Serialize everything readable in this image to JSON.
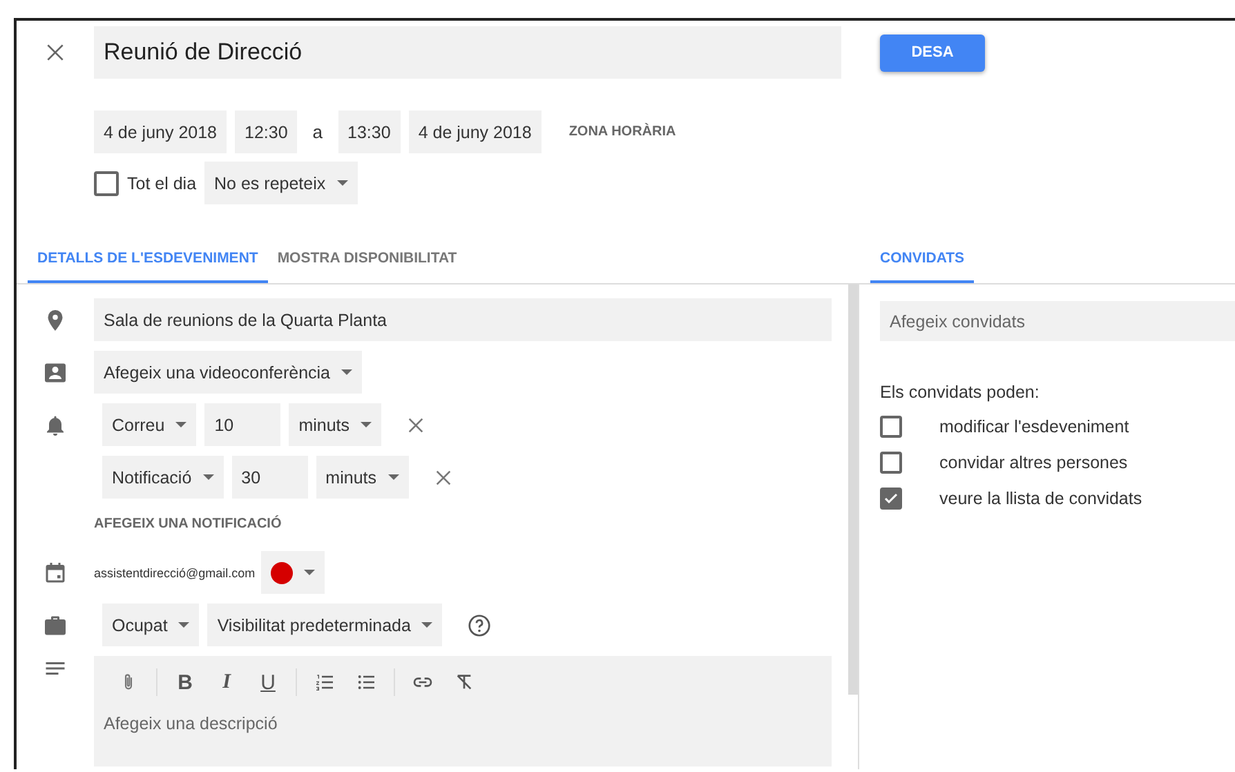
{
  "title": "Reunió de Direcció",
  "save_button": "DESA",
  "date_time": {
    "start_date": "4 de juny 2018",
    "start_time": "12:30",
    "separator": "a",
    "end_time": "13:30",
    "end_date": "4 de juny 2018",
    "time_zone": "ZONA HORÀRIA"
  },
  "all_day": {
    "label": "Tot el dia",
    "checked": false
  },
  "repeat": "No es repeteix",
  "tabs": [
    {
      "label": "DETALLS DE L'ESDEVENIMENT",
      "selected": true
    },
    {
      "label": "MOSTRA DISPONIBILITAT",
      "selected": false
    }
  ],
  "details": {
    "location": "Sala de reunions de la Quarta Planta",
    "conference": "Afegeix una videoconferència",
    "notifications": [
      {
        "method": "Correu",
        "amount": "10",
        "unit": "minuts"
      },
      {
        "method": "Notificació",
        "amount": "30",
        "unit": "minuts"
      }
    ],
    "add_notification": "AFEGEIX UNA NOTIFICACIÓ",
    "calendar": {
      "account": "assistentdirecció@gmail.com",
      "color": "#d50000"
    },
    "availability": "Ocupat",
    "visibility": "Visibilitat predeterminada",
    "format_buttons": [
      "B",
      "I",
      "U"
    ],
    "description": {
      "placeholder": "Afegeix una descripció"
    }
  },
  "guests": {
    "tab": {
      "label": "CONVIDATS",
      "selected": true
    },
    "add_field": {
      "placeholder": "Afegeix convidats"
    },
    "permissions_title": "Els convidats poden:",
    "permissions": [
      {
        "label": "modificar l'esdeveniment",
        "checked": false
      },
      {
        "label": "convidar altres persones",
        "checked": false
      },
      {
        "label": "veure la llista de convidats",
        "checked": true
      }
    ]
  }
}
